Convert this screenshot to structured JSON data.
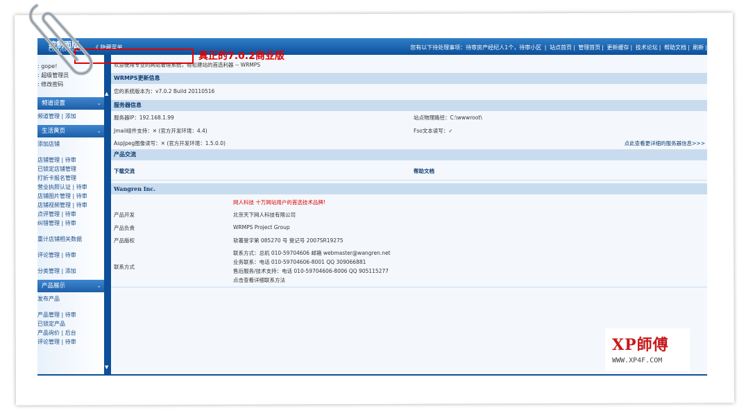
{
  "topbar": {
    "logo_title": "控制面版",
    "logo_sub": "Control Panel",
    "hide_menu": "《 隐藏菜单",
    "pending": "您有以下待处理事项：待审房产经纪人1个，待审小区",
    "links": [
      "站点首页",
      "管理首页",
      "更新缓存",
      "技术论坛",
      "帮助文档",
      "刷新"
    ]
  },
  "sidebar": {
    "user_lines": [
      ": gope!",
      ": 超级管理员",
      ": 修改密码"
    ],
    "sections": [
      {
        "title": "频道设置",
        "items": [
          "频道管理 | 添加"
        ]
      },
      {
        "title": "生活黄页",
        "items": [
          "添加店铺",
          "",
          "店铺管理 | 待审",
          "已锁定店铺管理",
          "打折卡报名管理",
          "营业执照认证 | 待审",
          "店铺图片管理 | 待审",
          "店铺视频管理 | 待审",
          "点评管理 | 待审",
          "纠错管理 | 待审",
          "",
          "重计店铺相关数据",
          "",
          "评论管理 | 待审",
          "",
          "分类管理 | 添加"
        ]
      },
      {
        "title": "产品展示",
        "items": [
          "发布产品",
          "",
          "产品管理 | 待审",
          "已锁定产品",
          "产品询价 | 后台",
          "评论管理 | 待审"
        ]
      }
    ]
  },
  "main": {
    "welcome": "欢迎使用专业的网站管理系统，轻松建站的首选利器 -- WRMPS",
    "update_header": "WRMPS更新信息",
    "version_text": "您的系统版本为：v7.0.2 Build 20110516",
    "annotation": "真正的7.0.2商业版",
    "server_header": "服务器信息",
    "server_ip": "服务器IP：192.168.1.99",
    "site_path": "站点物理路径：C:\\wwwroot\\",
    "jmail": "Jmail组件支持：✕  (官方开发环境：4.4)",
    "fso": "Fso文本读写：✓",
    "aspjpeg": "AspJpeg图像读写：✕  (官方开发环境：1.5.0.0)",
    "more_info": "点此查看更详细的服务器信息>>>",
    "product_header": "产品交流",
    "download": "下载交流",
    "help": "帮助文档",
    "company": "Wangren Inc.",
    "slogan": "网人科技 十万网站用户的首选技术品牌!",
    "dev_label": "产品开发",
    "dev_value": "北京天下网人科技有限公司",
    "lead_label": "产品负责",
    "lead_value": "WRMPS Project Group",
    "copyright_label": "产品版权",
    "copyright_value": "软著登字第 085270 号  登记号 2007SR19275",
    "contact_label": "联系方式",
    "contact_lines": [
      "联系方式：总机 010-59704606  邮箱 webmaster@wangren.net",
      "业务联系：电话 010-59704606-8001  QQ 309066881",
      "售后服务/技术支持：电话 010-59704606-8006  QQ 905115277",
      "点击查看详细联系方法"
    ]
  },
  "watermark": {
    "title": "XP師傅",
    "url": "WWW.XP4F.COM"
  },
  "colors": {
    "accent": "#0d4f99",
    "section_bg": "#c9dcef",
    "annotation_red": "#e00000"
  }
}
